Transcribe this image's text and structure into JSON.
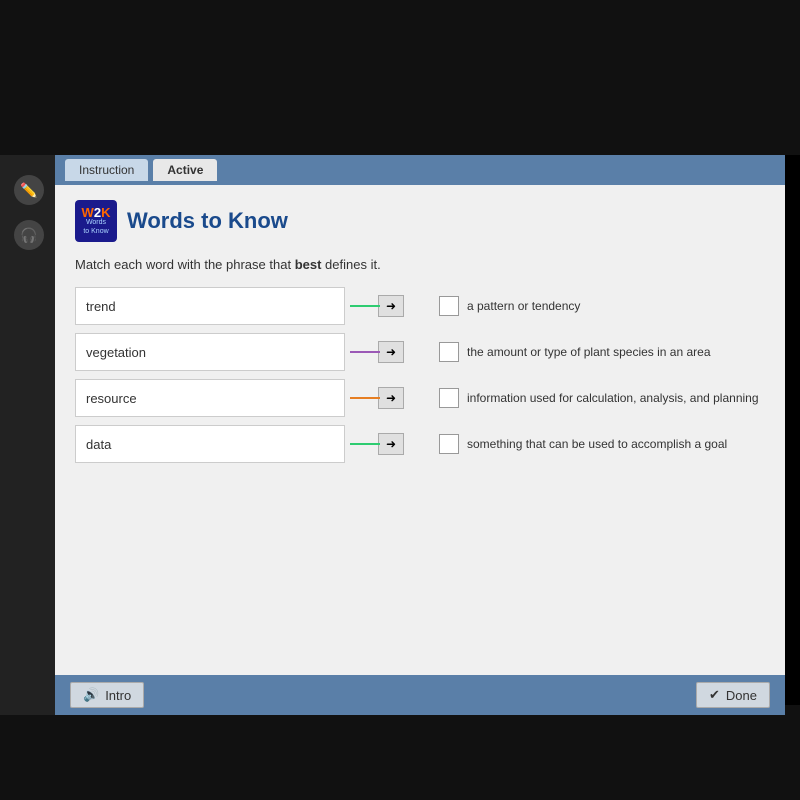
{
  "tabs": [
    {
      "label": "Instruction",
      "active": false
    },
    {
      "label": "Active",
      "active": true
    }
  ],
  "header": {
    "logo_line1": "W",
    "logo_line1_accent": "2K",
    "logo_subtitle": "Words\nto Know",
    "title": "Words to Know"
  },
  "instruction": {
    "prefix": "Match each word with the phrase that ",
    "bold": "best",
    "suffix": " defines it."
  },
  "words": [
    {
      "id": "trend",
      "label": "trend",
      "line_color": "#2ecc71"
    },
    {
      "id": "vegetation",
      "label": "vegetation",
      "line_color": "#9b59b6"
    },
    {
      "id": "resource",
      "label": "resource",
      "line_color": "#e67e22"
    },
    {
      "id": "data",
      "label": "data",
      "line_color": "#2ecc71"
    }
  ],
  "definitions": [
    {
      "id": "def1",
      "text": "a pattern or tendency"
    },
    {
      "id": "def2",
      "text": "the amount or type of plant species in an area"
    },
    {
      "id": "def3",
      "text": "information used for calculation, analysis, and planning"
    },
    {
      "id": "def4",
      "text": "something that can be used to accomplish a goal"
    }
  ],
  "bottom": {
    "intro_label": "Intro",
    "done_label": "Done"
  }
}
